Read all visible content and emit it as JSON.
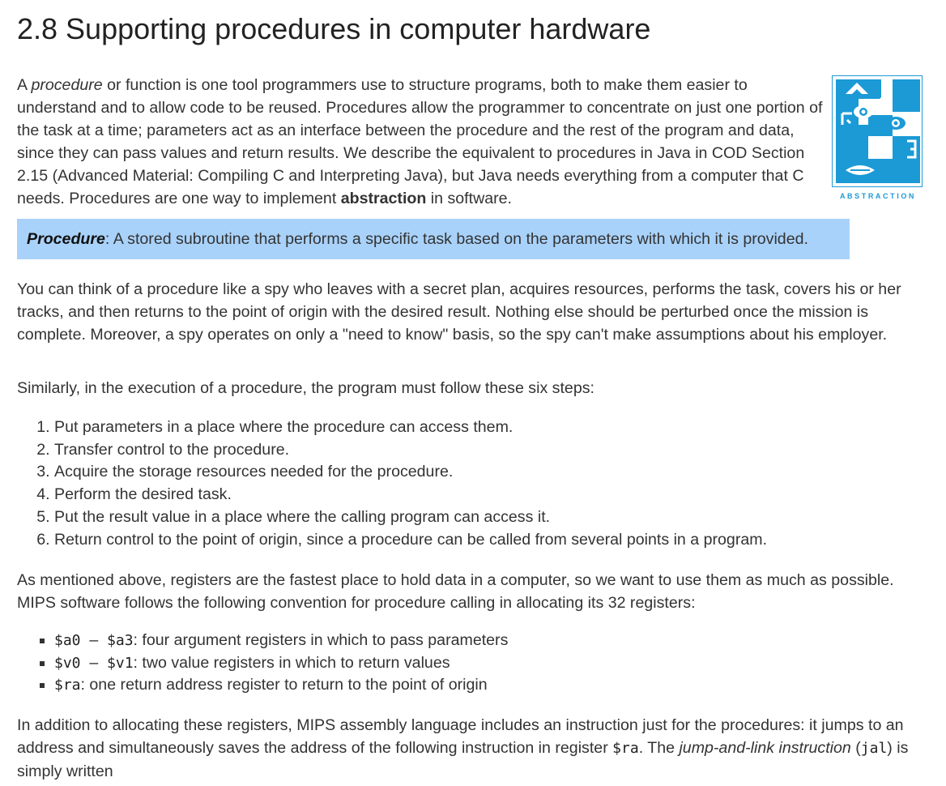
{
  "heading": "2.8 Supporting procedures in computer hardware",
  "intro": {
    "a": "A ",
    "procedure_em": "procedure",
    "b": " or function is one tool programmers use to structure programs, both to make them easier to understand and to allow code to be reused. Procedures allow the programmer to concentrate on just one portion of the task at a time; parameters act as an interface between the procedure and the rest of the program and data, since they can pass values and return results. We describe the equivalent to procedures in Java in COD Section 2.15 (Advanced Material: Compiling C and Interpreting Java), but Java needs everything from a computer that C needs. Procedures are one way to implement ",
    "abstraction_bold": "abstraction",
    "c": " in software."
  },
  "abstraction_icon": {
    "label": "ABSTRACTION",
    "icon": "abstraction-face-icon",
    "color": "#1b9ad6"
  },
  "definition": {
    "term": "Procedure",
    "text": ": A stored subroutine that performs a specific task based on the parameters with which it is provided.",
    "bg_color": "#a9d2fa"
  },
  "spy_paragraph": "You can think of a procedure like a spy who leaves with a secret plan, acquires resources, performs the task, covers his or her tracks, and then returns to the point of origin with the desired result. Nothing else should be perturbed once the mission is complete. Moreover, a spy operates on only a \"need to know\" basis, so the spy can't make assumptions about his employer.",
  "steps_intro": "Similarly, in the execution of a procedure, the program must follow these six steps:",
  "steps": [
    "Put parameters in a place where the procedure can access them.",
    "Transfer control to the procedure.",
    "Acquire the storage resources needed for the procedure.",
    "Perform the desired task.",
    "Put the result value in a place where the calling program can access it.",
    "Return control to the point of origin, since a procedure can be called from several points in a program."
  ],
  "registers_intro": "As mentioned above, registers are the fastest place to hold data in a computer, so we want to use them as much as possible. MIPS software follows the following convention for procedure calling in allocating its 32 registers:",
  "registers": [
    {
      "code": "$a0 – $a3",
      "text": ": four argument registers in which to pass parameters"
    },
    {
      "code": "$v0 – $v1",
      "text": ": two value registers in which to return values"
    },
    {
      "code": "$ra",
      "text": ": one return address register to return to the point of origin"
    }
  ],
  "jal_paragraph": {
    "a": "In addition to allocating these registers, MIPS assembly language includes an instruction just for the procedures: it jumps to an address and simultaneously saves the address of the following instruction in register ",
    "ra_code": "$ra",
    "b": ". The ",
    "jal_em": "jump-and-link instruction",
    "c": " (",
    "jal_code": "jal",
    "d": ") is simply written"
  }
}
